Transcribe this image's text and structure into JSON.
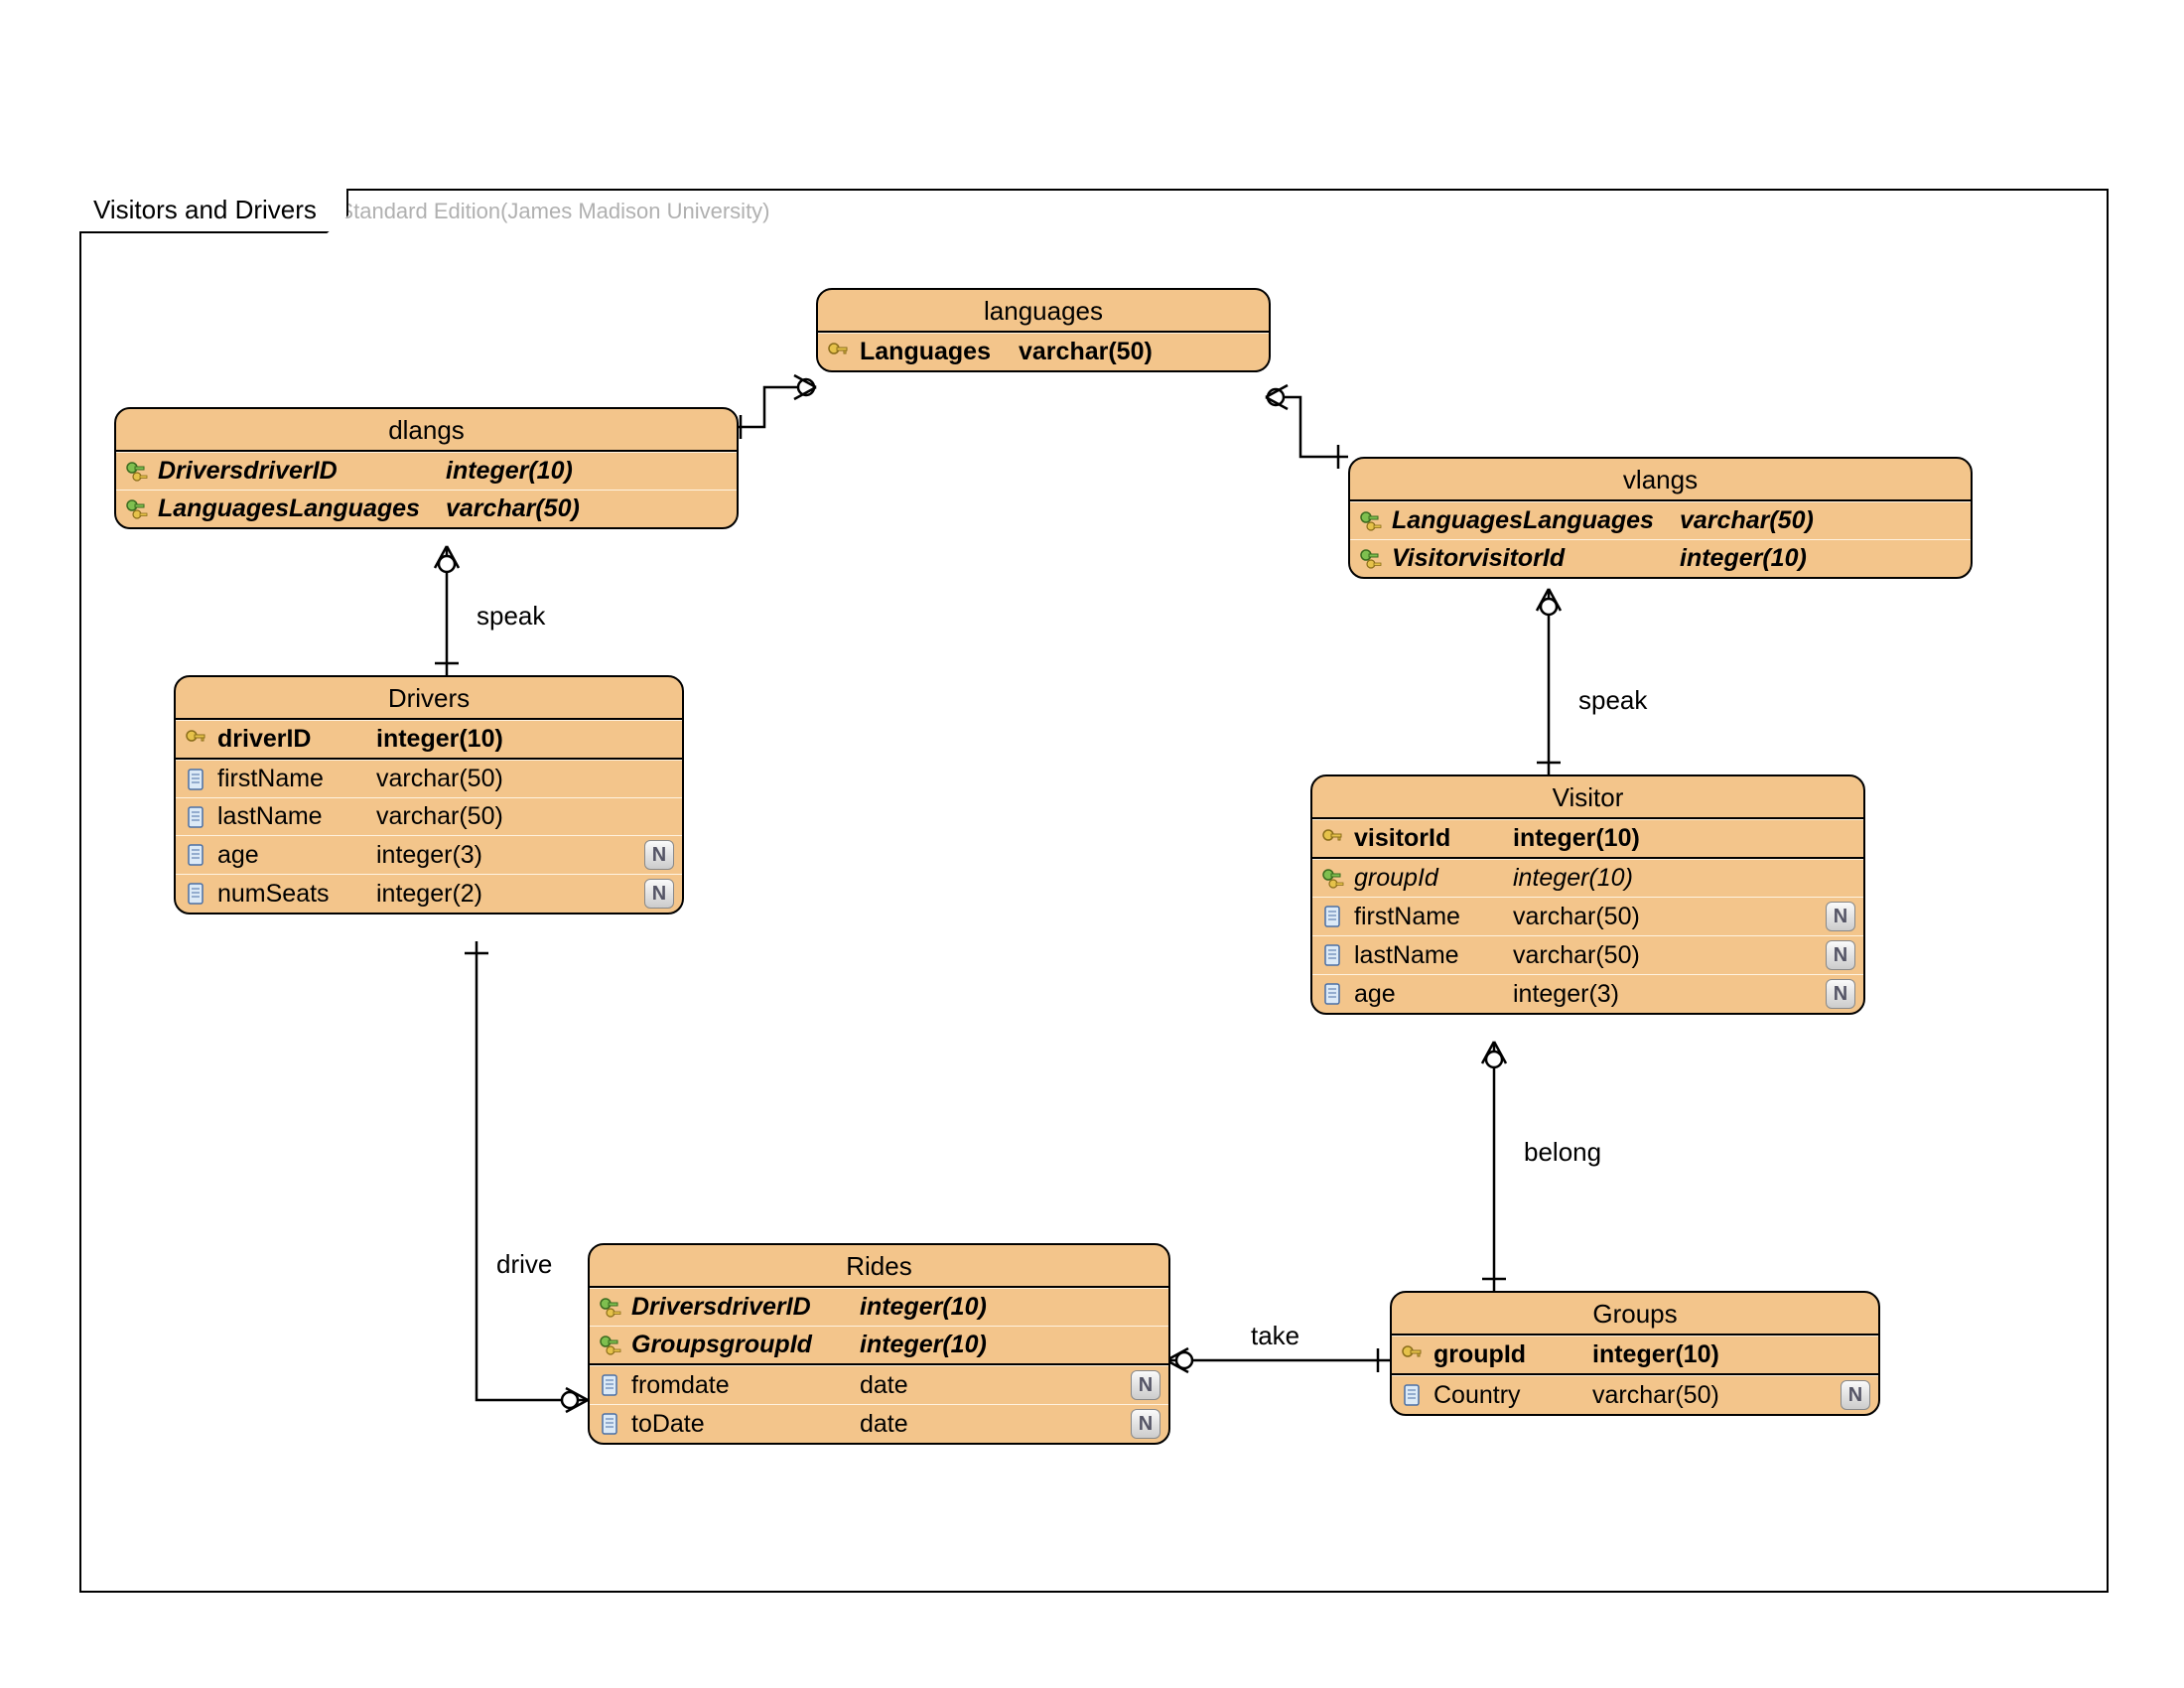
{
  "watermark": "Visual Paradigm for UML Standard Edition(James Madison University)",
  "frame_title": "Visitors and Drivers",
  "entities": {
    "languages": {
      "title": "languages",
      "rows": [
        {
          "name": "Languages",
          "type": "varchar(50)",
          "pk": true
        }
      ]
    },
    "dlangs": {
      "title": "dlangs",
      "rows": [
        {
          "name": "DriversdriverID",
          "type": "integer(10)",
          "fk": true,
          "bolditalic": true
        },
        {
          "name": "LanguagesLanguages",
          "type": "varchar(50)",
          "fk": true,
          "bolditalic": true
        }
      ]
    },
    "vlangs": {
      "title": "vlangs",
      "rows": [
        {
          "name": "LanguagesLanguages",
          "type": "varchar(50)",
          "fk": true,
          "bolditalic": true
        },
        {
          "name": "VisitorvisitorId",
          "type": "integer(10)",
          "fk": true,
          "bolditalic": true
        }
      ]
    },
    "drivers": {
      "title": "Drivers",
      "rows": [
        {
          "name": "driverID",
          "type": "integer(10)",
          "pk": true,
          "bold": true
        },
        {
          "name": "firstName",
          "type": "varchar(50)",
          "col": true
        },
        {
          "name": "lastName",
          "type": "varchar(50)",
          "col": true
        },
        {
          "name": "age",
          "type": "integer(3)",
          "col": true,
          "nullable": true
        },
        {
          "name": "numSeats",
          "type": "integer(2)",
          "col": true,
          "nullable": true
        }
      ]
    },
    "visitor": {
      "title": "Visitor",
      "rows": [
        {
          "name": "visitorId",
          "type": "integer(10)",
          "pk": true,
          "bold": true
        },
        {
          "name": "groupId",
          "type": "integer(10)",
          "fk": true,
          "italic": true
        },
        {
          "name": "firstName",
          "type": "varchar(50)",
          "col": true,
          "nullable": true
        },
        {
          "name": "lastName",
          "type": "varchar(50)",
          "col": true,
          "nullable": true
        },
        {
          "name": "age",
          "type": "integer(3)",
          "col": true,
          "nullable": true
        }
      ]
    },
    "rides": {
      "title": "Rides",
      "rows": [
        {
          "name": "DriversdriverID",
          "type": "integer(10)",
          "fk": true,
          "bolditalic": true
        },
        {
          "name": "GroupsgroupId",
          "type": "integer(10)",
          "fk": true,
          "bolditalic": true
        },
        {
          "name": "fromdate",
          "type": "date",
          "col": true,
          "nullable": true
        },
        {
          "name": "toDate",
          "type": "date",
          "col": true,
          "nullable": true
        }
      ]
    },
    "groups": {
      "title": "Groups",
      "rows": [
        {
          "name": "groupId",
          "type": "integer(10)",
          "pk": true,
          "bold": true
        },
        {
          "name": "Country",
          "type": "varchar(50)",
          "col": true,
          "nullable": true
        }
      ]
    }
  },
  "relationships": {
    "speak1": "speak",
    "speak2": "speak",
    "drive": "drive",
    "take": "take",
    "belong": "belong"
  }
}
